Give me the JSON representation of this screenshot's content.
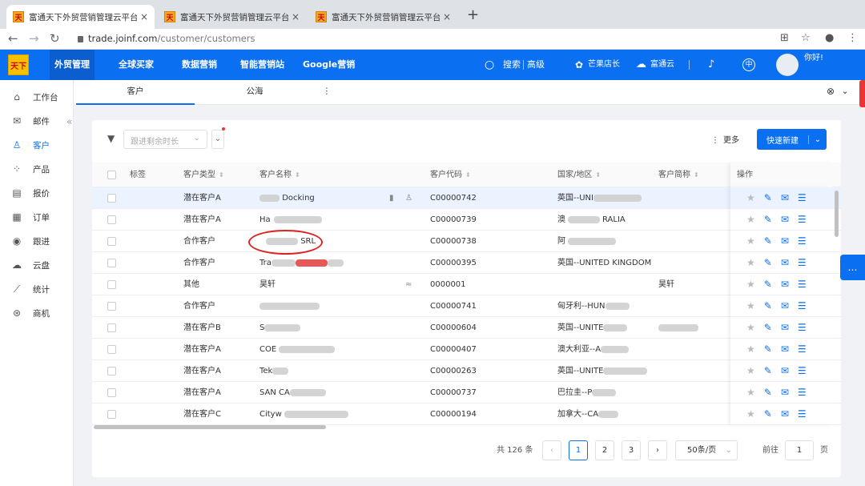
{
  "browser": {
    "tabs": [
      {
        "title": "富通天下外贸营销管理云平台",
        "favicon": "天"
      },
      {
        "title": "富通天下外贸营销管理云平台",
        "favicon": "天"
      },
      {
        "title": "富通天下外贸营销管理云平台",
        "favicon": "天"
      }
    ],
    "close_glyph": "×",
    "new_tab_glyph": "+",
    "url_host": "trade.joinf.com",
    "url_path": "/customer/customers"
  },
  "topbar": {
    "logo_text": "天下",
    "nav": [
      "外贸管理",
      "全球买家",
      "数据营销",
      "智能营销站",
      "Google营销"
    ],
    "search": "搜索",
    "advanced": "高级",
    "mango": "芒果店长",
    "cloud": "富通云",
    "lang_glyph": "中",
    "greeting": "你好!"
  },
  "sidebar": {
    "items": [
      {
        "label": "工作台",
        "icon": "home-icon"
      },
      {
        "label": "邮件",
        "icon": "mail-icon"
      },
      {
        "label": "客户",
        "icon": "user-icon"
      },
      {
        "label": "产品",
        "icon": "grid-icon"
      },
      {
        "label": "报价",
        "icon": "quote-icon"
      },
      {
        "label": "订单",
        "icon": "order-icon"
      },
      {
        "label": "跟进",
        "icon": "location-icon"
      },
      {
        "label": "云盘",
        "icon": "cloud-icon"
      },
      {
        "label": "统计",
        "icon": "chart-icon"
      },
      {
        "label": "商机",
        "icon": "opportunity-icon"
      }
    ],
    "collapse_glyph": "«"
  },
  "subtabs": {
    "tabs": [
      "客户",
      "公海"
    ],
    "more_glyph": "⋮"
  },
  "toolbar": {
    "filter_placeholder": "跟进剩余时长",
    "more_label": "更多",
    "new_label": "快速新建"
  },
  "table": {
    "headers": [
      "标签",
      "客户类型",
      "客户名称",
      "客户代码",
      "国家/地区",
      "客户简称",
      "操作"
    ],
    "rows": [
      {
        "type": "潜在客户A",
        "name": "Docking",
        "code": "C00000742",
        "country": "英国--UNI",
        "short": ""
      },
      {
        "type": "潜在客户A",
        "name": "Ha",
        "code": "C00000739",
        "country": "澳",
        "country_tail": "RALIA",
        "short": ""
      },
      {
        "type": "合作客户",
        "name": "SRL",
        "code": "C00000738",
        "country": "阿",
        "short": ""
      },
      {
        "type": "合作客户",
        "name": "Tra",
        "code": "C00000395",
        "country": "英国--UNITED KINGDOM",
        "short": ""
      },
      {
        "type": "其他",
        "name": "昊轩",
        "code": "0000001",
        "country": "",
        "short": "昊轩"
      },
      {
        "type": "合作客户",
        "name": "",
        "code": "C00000741",
        "country": "匈牙利--HUN",
        "short": ""
      },
      {
        "type": "潜在客户B",
        "name": "S",
        "code": "C00000604",
        "country": "英国--UNITE",
        "short": ""
      },
      {
        "type": "潜在客户A",
        "name": "COE",
        "code": "C00000407",
        "country": "澳大利亚--A",
        "short": ""
      },
      {
        "type": "潜在客户A",
        "name": "Tek",
        "code": "C00000263",
        "country": "英国--UNITE",
        "short": ""
      },
      {
        "type": "潜在客户A",
        "name": "SAN CA",
        "code": "C00000737",
        "country": "巴拉圭--P",
        "short": ""
      },
      {
        "type": "潜在客户C",
        "name": "Cityw",
        "code": "C00000194",
        "country": "加拿大--CA",
        "short": ""
      }
    ]
  },
  "pagination": {
    "total": "共 126 条",
    "pages": [
      "1",
      "2",
      "3"
    ],
    "per_page": "50条/页",
    "goto_label": "前往",
    "goto_value": "1",
    "page_label": "页"
  },
  "colors": {
    "primary": "#0b6ff1",
    "annotation": "#dd2222"
  }
}
